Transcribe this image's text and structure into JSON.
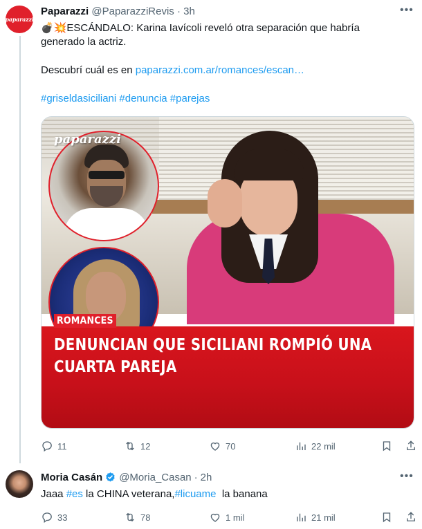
{
  "tweet1": {
    "author_name": "Paparazzi",
    "handle": "@PaparazziRevis",
    "separator": "·",
    "time": "3h",
    "avatar_text": "paparazzi",
    "line1": "💣💥ESCÁNDALO: Karina Iavícoli reveló otra separación que habría",
    "line2": "generado la actriz.",
    "line3_prefix": "Descubrí cuál es en ",
    "link": "paparazzi.com.ar/romances/escan…",
    "hashtags": [
      "#griseldasiciliani",
      "#denuncia",
      "#parejas"
    ],
    "media": {
      "logo": "paparazzi",
      "tag": "ROMANCES",
      "headline_line1": "DENUNCIAN QUE SICILIANI ROMPIÓ UNA",
      "headline_line2": "CUARTA PAREJA"
    },
    "actions": {
      "replies": "11",
      "retweets": "12",
      "likes": "70",
      "views": "22 mil"
    }
  },
  "tweet2": {
    "author_name": "Moria Casán",
    "handle": "@Moria_Casan",
    "separator": "·",
    "time": "2h",
    "text_a": "Jaaa ",
    "hashtag1": "#es",
    "text_b": " la CHINA veterana,",
    "hashtag2": "#licuame",
    "text_c": "  la banana",
    "actions": {
      "replies": "33",
      "retweets": "78",
      "likes": "1 mil",
      "views": "21 mil"
    }
  },
  "colors": {
    "link_blue": "#1d9bf0",
    "secondary_text": "#536471",
    "brand_red": "#e0202b",
    "verified_blue": "#1d9bf0"
  },
  "icons": [
    "more-icon",
    "reply-icon",
    "retweet-icon",
    "like-icon",
    "views-icon",
    "bookmark-icon",
    "share-icon",
    "verified-icon"
  ]
}
